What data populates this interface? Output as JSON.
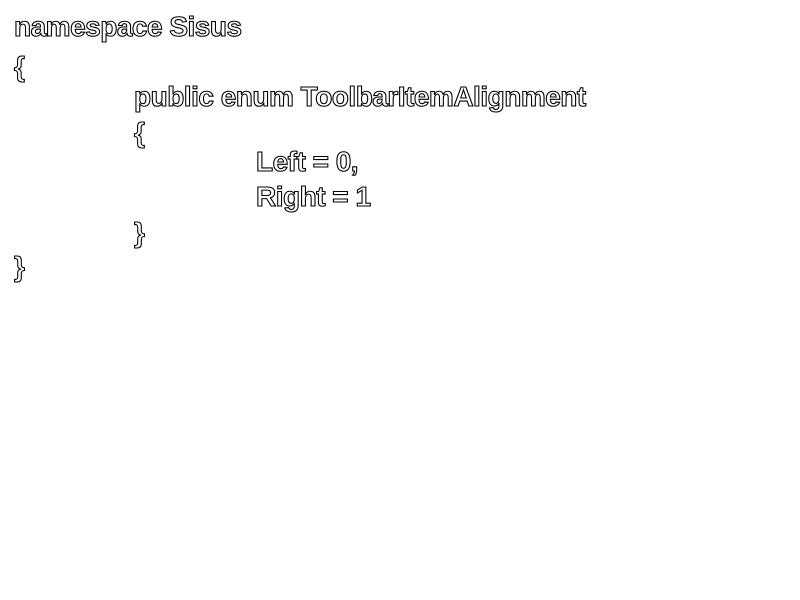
{
  "code": {
    "line_1": "namespace Sisus",
    "line_2": "{",
    "line_3": "public enum ToolbarItemAlignment",
    "line_4": "{",
    "line_5": "Left = 0,",
    "line_6": "Right = 1",
    "line_7": "}",
    "line_8": "}"
  },
  "colors": {
    "background": "#ffffff",
    "text_fill": "#ffffff",
    "text_outline": "#000000"
  }
}
